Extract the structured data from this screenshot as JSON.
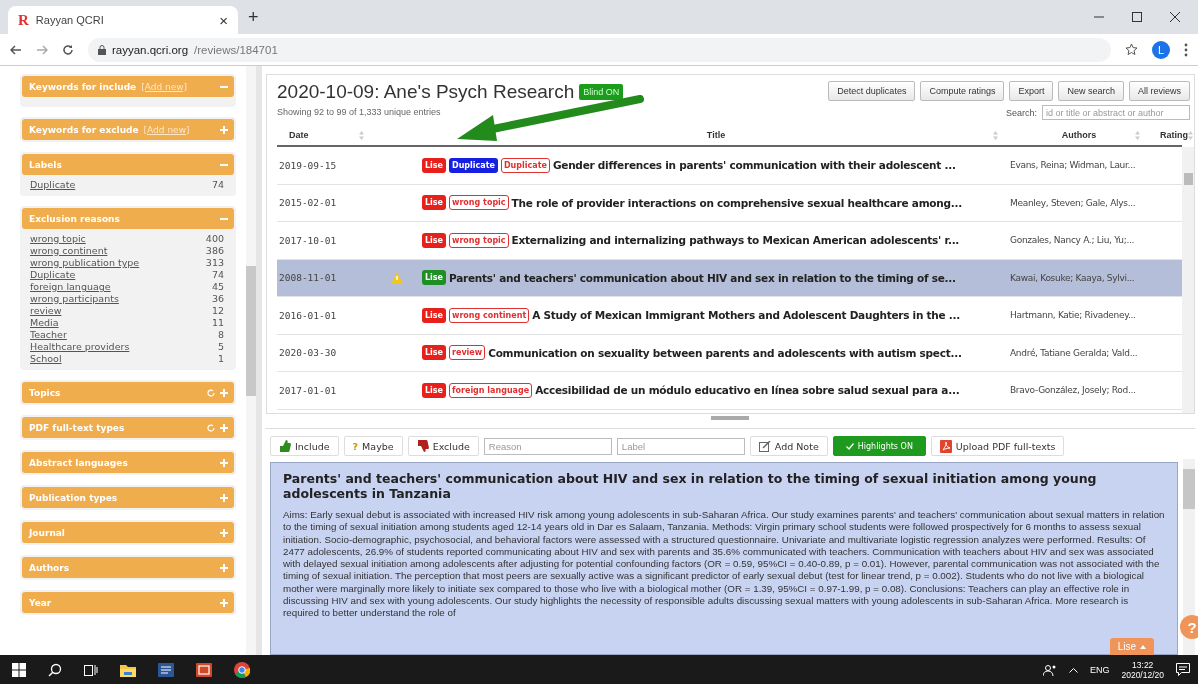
{
  "browser": {
    "logo": "R",
    "tab_title": "Rayyan QCRI",
    "tab_close": "×",
    "new_tab": "+",
    "url_host": "rayyan.qcri.org",
    "url_path": "/reviews/184701",
    "profile_initial": "L"
  },
  "sidebar": {
    "panels": [
      {
        "title": "Keywords for include",
        "add_link": "[Add new]",
        "expanded": true,
        "refresh": false
      },
      {
        "title": "Keywords for exclude",
        "add_link": "[Add new]",
        "expanded": false,
        "refresh": false
      },
      {
        "title": "Labels",
        "expanded": true,
        "refresh": false,
        "items": [
          {
            "name": "Duplicate",
            "count": "74"
          }
        ]
      },
      {
        "title": "Exclusion reasons",
        "expanded": true,
        "refresh": false,
        "items": [
          {
            "name": "wrong topic",
            "count": "400"
          },
          {
            "name": "wrong continent",
            "count": "386"
          },
          {
            "name": "wrong publication type",
            "count": "313"
          },
          {
            "name": "Duplicate",
            "count": "74"
          },
          {
            "name": "foreign language",
            "count": "45"
          },
          {
            "name": "wrong participants",
            "count": "36"
          },
          {
            "name": "review",
            "count": "12"
          },
          {
            "name": "Media",
            "count": "11"
          },
          {
            "name": "Teacher",
            "count": "8"
          },
          {
            "name": "Healthcare providers",
            "count": "5"
          },
          {
            "name": "School",
            "count": "1"
          }
        ]
      },
      {
        "title": "Topics",
        "expanded": false,
        "refresh": true
      },
      {
        "title": "PDF full-text types",
        "expanded": false,
        "refresh": true
      },
      {
        "title": "Abstract languages",
        "expanded": false,
        "refresh": false
      },
      {
        "title": "Publication types",
        "expanded": false,
        "refresh": false
      },
      {
        "title": "Journal",
        "expanded": false,
        "refresh": false
      },
      {
        "title": "Authors",
        "expanded": false,
        "refresh": false
      },
      {
        "title": "Year",
        "expanded": false,
        "refresh": false
      }
    ]
  },
  "review": {
    "title": "2020-10-09: Ane's Psych Research",
    "blind_badge": "Blind ON",
    "summary": "Showing 92 to 99 of 1,333 unique entries",
    "buttons": [
      "Detect duplicates",
      "Compute ratings",
      "Export",
      "New search",
      "All reviews"
    ],
    "search_label": "Search:",
    "search_placeholder": "id or title or abstract or author",
    "columns": [
      "Date",
      "Title",
      "Authors",
      "Rating"
    ],
    "rows": [
      {
        "date": "2019-09-15",
        "selected": false,
        "flagged": false,
        "tags": [
          {
            "text": "Lise",
            "kind": "decision",
            "included": false
          },
          {
            "text": "Duplicate",
            "kind": "label"
          },
          {
            "text": "Duplicate",
            "kind": "reason"
          }
        ],
        "title": "Gender differences in parents' communication with their adolescent ...",
        "authors": "Evans, Reina; Widman, Laur..."
      },
      {
        "date": "2015-02-01",
        "selected": false,
        "flagged": false,
        "tags": [
          {
            "text": "Lise",
            "kind": "decision",
            "included": false
          },
          {
            "text": "wrong topic",
            "kind": "reason"
          }
        ],
        "title": "The role of provider interactions on comprehensive sexual healthcare among...",
        "authors": "Meanley, Steven; Gale, Alys..."
      },
      {
        "date": "2017-10-01",
        "selected": false,
        "flagged": false,
        "tags": [
          {
            "text": "Lise",
            "kind": "decision",
            "included": false
          },
          {
            "text": "wrong topic",
            "kind": "reason"
          }
        ],
        "title": "Externalizing and internalizing pathways to Mexican American adolescents' r...",
        "authors": "Gonzales, Nancy A.; Liu, Yu;..."
      },
      {
        "date": "2008-11-01",
        "selected": true,
        "flagged": true,
        "tags": [
          {
            "text": "Lise",
            "kind": "decision",
            "included": true
          }
        ],
        "title": "Parents' and teachers' communication about HIV and sex in relation to the timing of se...",
        "authors": "Kawai, Kosuke; Kaaya, Sylvi..."
      },
      {
        "date": "2016-01-01",
        "selected": false,
        "flagged": false,
        "tags": [
          {
            "text": "Lise",
            "kind": "decision",
            "included": false
          },
          {
            "text": "wrong continent",
            "kind": "reason"
          }
        ],
        "title": "A Study of Mexican Immigrant Mothers and Adolescent Daughters in the ...",
        "authors": "Hartmann, Katie; Rivadeney..."
      },
      {
        "date": "2020-03-30",
        "selected": false,
        "flagged": false,
        "tags": [
          {
            "text": "Lise",
            "kind": "decision",
            "included": false
          },
          {
            "text": "review",
            "kind": "reason"
          }
        ],
        "title": "Communication on sexuality between parents and adolescents with autism spect...",
        "authors": "André, Tatiane Geralda; Vald..."
      },
      {
        "date": "2017-01-01",
        "selected": false,
        "flagged": false,
        "tags": [
          {
            "text": "Lise",
            "kind": "decision",
            "included": false
          },
          {
            "text": "foreign language",
            "kind": "reason"
          }
        ],
        "title": "Accesibilidad de un módulo educativo en línea sobre salud sexual para a...",
        "authors": "Bravo-González, Josely; Rod..."
      }
    ]
  },
  "detail": {
    "include": "Include",
    "maybe_icon": "?",
    "maybe": "Maybe",
    "exclude": "Exclude",
    "reason_placeholder": "Reason",
    "label_placeholder": "Label",
    "add_note": "Add Note",
    "highlights": {
      "label": "Highlights ON",
      "on": true
    },
    "upload": "Upload PDF full-texts",
    "abstract_title": "Parents' and teachers' communication about HIV and sex in relation to the timing of sexual initiation among young adolescents in Tanzania",
    "abstract": "Aims: Early sexual debut is associated with increased HIV risk among young adolescents in sub-Saharan Africa. Our study examines parents' and teachers' communication about sexual matters in relation to the timing of sexual initiation among students aged 12-14 years old in Dar es Salaam, Tanzania. Methods: Virgin primary school students were followed prospectively for 6 months to assess sexual initiation. Socio-demographic, psychosocial, and behavioral factors were assessed with a structured questionnaire. Univariate and multivariate logistic regression analyzes were performed. Results: Of 2477 adolescents, 26.9% of students reported communicating about HIV and sex with parents and 35.6% communicated with teachers. Communication with teachers about HIV and sex was associated with delayed sexual initiation among adolescents after adjusting for potential confounding factors (OR = 0.59, 95%CI = 0.40-0.89, p = 0.01). However, parental communication was not associated with the timing of sexual initiation. The perception that most peers are sexually active was a significant predictor of early sexual debut (test for linear trend, p = 0.002). Students who do not live with a biological mother were marginally more likely to initiate sex compared to those who live with a biological mother (OR = 1.39, 95%CI = 0.97-1.99, p = 0.08). Conclusions: Teachers can play an effective role in discussing HIV and sex with young adolescents. Our study highlights the necessity of responsible adults discussing sexual matters with young adolescents in sub-Saharan Africa. More research is required to better understand the role of",
    "user_button": "Lise",
    "help": "?"
  },
  "taskbar": {
    "language": "ENG",
    "time": "13:22",
    "date": "2020/12/20"
  }
}
